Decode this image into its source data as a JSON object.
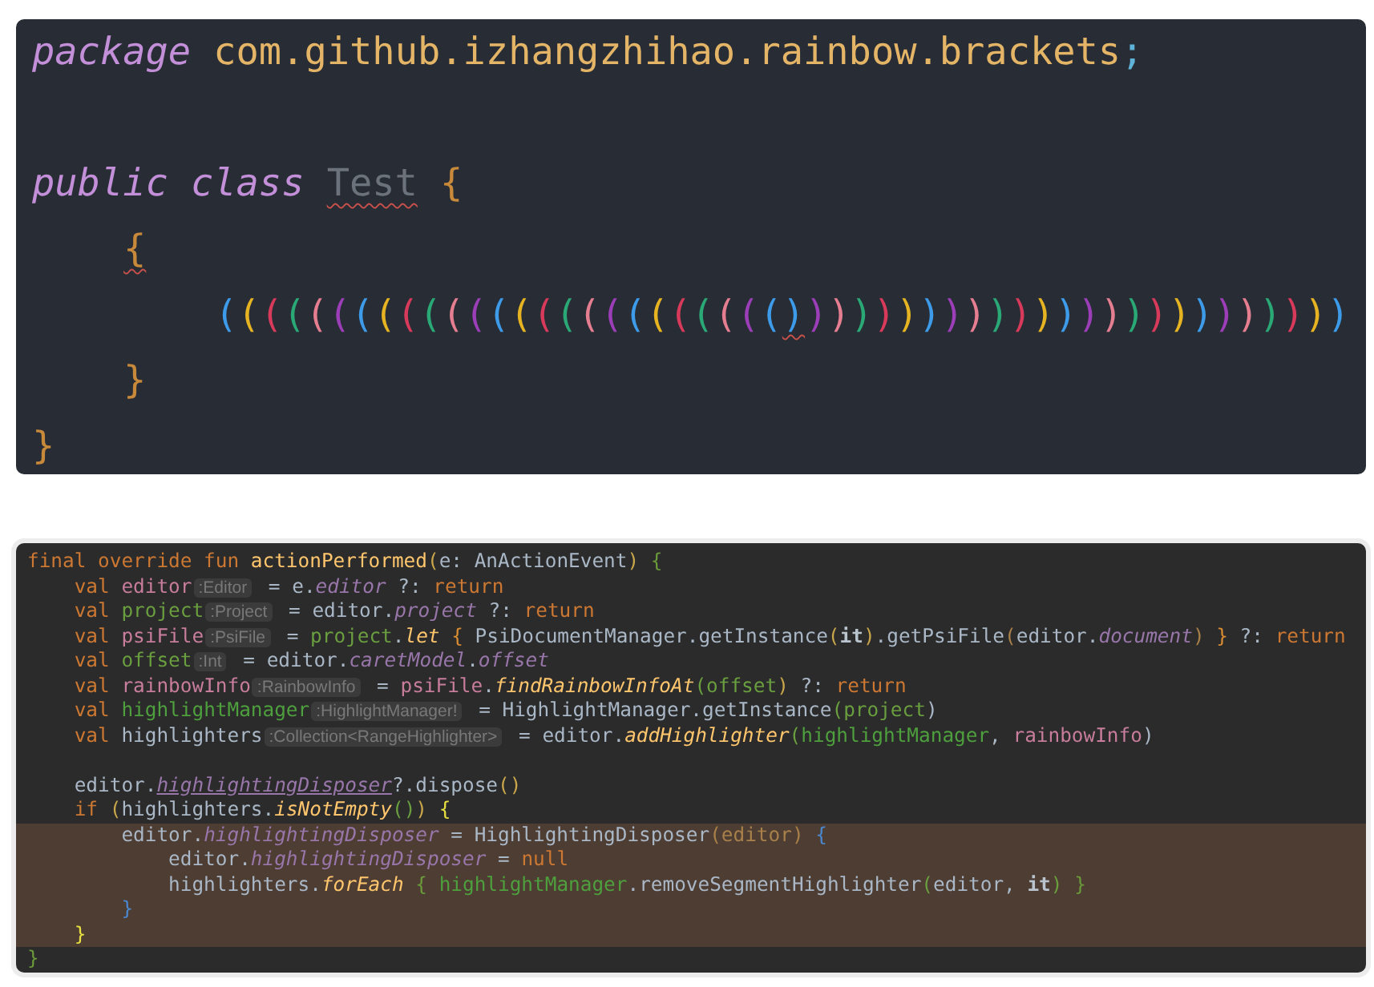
{
  "top_editor": {
    "lines": [
      {
        "kind": "code",
        "spaced": false,
        "tokens": [
          {
            "text": "package",
            "kind": "kw",
            "warned": false
          },
          {
            "text": "com.github.izhangzhihao.rainbow.brackets",
            "kind": "pkg",
            "warned": false
          },
          {
            "text": ";",
            "kind": "semi",
            "warned": false
          }
        ]
      },
      {
        "kind": "code",
        "spaced": true,
        "tokens": [
          {
            "text": "public",
            "kind": "kw",
            "warned": false
          },
          {
            "text": "class",
            "kind": "kw",
            "warned": false
          },
          {
            "text": "Test",
            "kind": "unused",
            "warned": true
          },
          {
            "text": "{",
            "kind": "brace",
            "warned": false
          }
        ],
        "children": [
          {
            "kind": "code",
            "spaced": false,
            "tokens": [
              {
                "text": "{",
                "kind": "brace",
                "warned": true
              }
            ],
            "children": [
              {
                "kind": "brackets",
                "spaced": false,
                "brackets": [
                  {
                    "text": "(",
                    "color": "#3d9be9",
                    "warned": false
                  },
                  {
                    "text": "(",
                    "color": "#e6b422",
                    "warned": false
                  },
                  {
                    "text": "(",
                    "color": "#d73a5a",
                    "warned": false
                  },
                  {
                    "text": "(",
                    "color": "#2aa876",
                    "warned": false
                  },
                  {
                    "text": "(",
                    "color": "#e57e90",
                    "warned": false
                  },
                  {
                    "text": "(",
                    "color": "#9c3eb8",
                    "warned": false
                  },
                  {
                    "text": "(",
                    "color": "#3d9be9",
                    "warned": false
                  },
                  {
                    "text": "(",
                    "color": "#e6b422",
                    "warned": false
                  },
                  {
                    "text": "(",
                    "color": "#d73a5a",
                    "warned": false
                  },
                  {
                    "text": "(",
                    "color": "#2aa876",
                    "warned": false
                  },
                  {
                    "text": "(",
                    "color": "#e57e90",
                    "warned": false
                  },
                  {
                    "text": "(",
                    "color": "#9c3eb8",
                    "warned": false
                  },
                  {
                    "text": "(",
                    "color": "#3d9be9",
                    "warned": false
                  },
                  {
                    "text": "(",
                    "color": "#e6b422",
                    "warned": false
                  },
                  {
                    "text": "(",
                    "color": "#d73a5a",
                    "warned": false
                  },
                  {
                    "text": "(",
                    "color": "#2aa876",
                    "warned": false
                  },
                  {
                    "text": "(",
                    "color": "#e57e90",
                    "warned": false
                  },
                  {
                    "text": "(",
                    "color": "#9c3eb8",
                    "warned": false
                  },
                  {
                    "text": "(",
                    "color": "#3d9be9",
                    "warned": false
                  },
                  {
                    "text": "(",
                    "color": "#e6b422",
                    "warned": false
                  },
                  {
                    "text": "(",
                    "color": "#d73a5a",
                    "warned": false
                  },
                  {
                    "text": "(",
                    "color": "#2aa876",
                    "warned": false
                  },
                  {
                    "text": "(",
                    "color": "#e57e90",
                    "warned": false
                  },
                  {
                    "text": "(",
                    "color": "#9c3eb8",
                    "warned": false
                  },
                  {
                    "text": "(",
                    "color": "#3d9be9",
                    "warned": false
                  },
                  {
                    "text": ")",
                    "color": "#3d9be9",
                    "warned": true
                  },
                  {
                    "text": ")",
                    "color": "#9c3eb8",
                    "warned": false
                  },
                  {
                    "text": ")",
                    "color": "#e57e90",
                    "warned": false
                  },
                  {
                    "text": ")",
                    "color": "#2aa876",
                    "warned": false
                  },
                  {
                    "text": ")",
                    "color": "#d73a5a",
                    "warned": false
                  },
                  {
                    "text": ")",
                    "color": "#e6b422",
                    "warned": false
                  },
                  {
                    "text": ")",
                    "color": "#3d9be9",
                    "warned": false
                  },
                  {
                    "text": ")",
                    "color": "#9c3eb8",
                    "warned": false
                  },
                  {
                    "text": ")",
                    "color": "#e57e90",
                    "warned": false
                  },
                  {
                    "text": ")",
                    "color": "#2aa876",
                    "warned": false
                  },
                  {
                    "text": ")",
                    "color": "#d73a5a",
                    "warned": false
                  },
                  {
                    "text": ")",
                    "color": "#e6b422",
                    "warned": false
                  },
                  {
                    "text": ")",
                    "color": "#3d9be9",
                    "warned": false
                  },
                  {
                    "text": ")",
                    "color": "#9c3eb8",
                    "warned": false
                  },
                  {
                    "text": ")",
                    "color": "#e57e90",
                    "warned": false
                  },
                  {
                    "text": ")",
                    "color": "#2aa876",
                    "warned": false
                  },
                  {
                    "text": ")",
                    "color": "#d73a5a",
                    "warned": false
                  },
                  {
                    "text": ")",
                    "color": "#e6b422",
                    "warned": false
                  },
                  {
                    "text": ")",
                    "color": "#3d9be9",
                    "warned": false
                  },
                  {
                    "text": ")",
                    "color": "#9c3eb8",
                    "warned": false
                  },
                  {
                    "text": ")",
                    "color": "#e57e90",
                    "warned": false
                  },
                  {
                    "text": ")",
                    "color": "#2aa876",
                    "warned": false
                  },
                  {
                    "text": ")",
                    "color": "#d73a5a",
                    "warned": false
                  },
                  {
                    "text": ")",
                    "color": "#e6b422",
                    "warned": false
                  },
                  {
                    "text": ")",
                    "color": "#3d9be9",
                    "warned": false
                  }
                ]
              }
            ]
          },
          {
            "kind": "code",
            "spaced": false,
            "tokens": [
              {
                "text": "}",
                "kind": "brace",
                "warned": false
              }
            ]
          }
        ]
      },
      {
        "kind": "code",
        "spaced": false,
        "tokens": [
          {
            "text": "}",
            "kind": "brace",
            "warned": false
          }
        ]
      }
    ]
  },
  "bottom_editor": {
    "blocks": [
      {
        "lines": [
          {
            "highlighted": false,
            "tokens": [
              {
                "text": "final override fun ",
                "kind": "kw"
              },
              {
                "text": "actionPerformed",
                "kind": "fn-plain"
              },
              {
                "text": "(",
                "kind": "c",
                "color": "#c9a64a"
              },
              {
                "text": "e: AnActionEvent",
                "kind": "text"
              },
              {
                "text": ") ",
                "kind": "c",
                "color": "#c9a64a"
              },
              {
                "text": "{",
                "kind": "c",
                "color": "#6a9a3a"
              }
            ]
          },
          {
            "highlighted": false,
            "tokens": [
              {
                "text": "    val ",
                "kind": "kw"
              },
              {
                "text": "editor",
                "kind": "c",
                "color": "#c77d9b"
              },
              {
                "text": ":Editor",
                "kind": "hint"
              },
              {
                "text": " = e.",
                "kind": "text"
              },
              {
                "text": "editor",
                "kind": "prop"
              },
              {
                "text": " ?: ",
                "kind": "text"
              },
              {
                "text": "return",
                "kind": "kw"
              }
            ]
          },
          {
            "highlighted": false,
            "tokens": [
              {
                "text": "    val ",
                "kind": "kw"
              },
              {
                "text": "project",
                "kind": "c",
                "color": "#6a9f3f"
              },
              {
                "text": ":Project",
                "kind": "hint"
              },
              {
                "text": " = editor.",
                "kind": "text"
              },
              {
                "text": "project",
                "kind": "prop"
              },
              {
                "text": " ?: ",
                "kind": "text"
              },
              {
                "text": "return",
                "kind": "kw"
              }
            ]
          },
          {
            "highlighted": false,
            "tokens": [
              {
                "text": "    val ",
                "kind": "kw"
              },
              {
                "text": "psiFile",
                "kind": "c",
                "color": "#c77d9b"
              },
              {
                "text": ":PsiFile",
                "kind": "hint"
              },
              {
                "text": " = ",
                "kind": "text"
              },
              {
                "text": "project",
                "kind": "c",
                "color": "#6a9f3f"
              },
              {
                "text": ".",
                "kind": "text"
              },
              {
                "text": "let ",
                "kind": "fn"
              },
              {
                "text": "{",
                "kind": "c",
                "color": "#d98c32"
              },
              {
                "text": " PsiDocumentManager.getInstance",
                "kind": "text"
              },
              {
                "text": "(",
                "kind": "c",
                "color": "#c9a64a"
              },
              {
                "text": "it",
                "kind": "bold"
              },
              {
                "text": ")",
                "kind": "c",
                "color": "#c9a64a"
              },
              {
                "text": ".getPsiFile",
                "kind": "text"
              },
              {
                "text": "(",
                "kind": "c",
                "color": "#a8804a"
              },
              {
                "text": "editor.",
                "kind": "text"
              },
              {
                "text": "document",
                "kind": "prop"
              },
              {
                "text": ") ",
                "kind": "c",
                "color": "#a8804a"
              },
              {
                "text": "}",
                "kind": "c",
                "color": "#d98c32"
              },
              {
                "text": " ?: ",
                "kind": "text"
              },
              {
                "text": "return",
                "kind": "kw"
              }
            ]
          },
          {
            "highlighted": false,
            "tokens": [
              {
                "text": "    val ",
                "kind": "kw"
              },
              {
                "text": "offset",
                "kind": "c",
                "color": "#6a9f3f"
              },
              {
                "text": ":Int",
                "kind": "hint"
              },
              {
                "text": " = editor.",
                "kind": "text"
              },
              {
                "text": "caretModel",
                "kind": "prop"
              },
              {
                "text": ".",
                "kind": "text"
              },
              {
                "text": "offset",
                "kind": "prop"
              }
            ]
          },
          {
            "highlighted": false,
            "tokens": [
              {
                "text": "    val ",
                "kind": "kw"
              },
              {
                "text": "rainbowInfo",
                "kind": "c",
                "color": "#c77d9b"
              },
              {
                "text": ":RainbowInfo",
                "kind": "hint"
              },
              {
                "text": " = ",
                "kind": "text"
              },
              {
                "text": "psiFile",
                "kind": "c",
                "color": "#c77d9b"
              },
              {
                "text": ".",
                "kind": "text"
              },
              {
                "text": "findRainbowInfoAt",
                "kind": "fn"
              },
              {
                "text": "(",
                "kind": "c",
                "color": "#6a9f3f"
              },
              {
                "text": "offset",
                "kind": "c",
                "color": "#6a9f3f"
              },
              {
                "text": ")",
                "kind": "c",
                "color": "#c9a64a"
              },
              {
                "text": " ?: ",
                "kind": "text"
              },
              {
                "text": "return",
                "kind": "kw"
              }
            ]
          },
          {
            "highlighted": false,
            "tokens": [
              {
                "text": "    val ",
                "kind": "kw"
              },
              {
                "text": "highlightManager",
                "kind": "c",
                "color": "#4e9f3d"
              },
              {
                "text": ":HighlightManager!",
                "kind": "hint"
              },
              {
                "text": " = HighlightManager.getInstance",
                "kind": "text"
              },
              {
                "text": "(",
                "kind": "c",
                "color": "#6a9f3f"
              },
              {
                "text": "project",
                "kind": "c",
                "color": "#6a9f3f"
              },
              {
                "text": ")",
                "kind": "c",
                "color": "#a9b7c6"
              }
            ]
          },
          {
            "highlighted": false,
            "tokens": [
              {
                "text": "    val ",
                "kind": "kw"
              },
              {
                "text": "highlighters",
                "kind": "text"
              },
              {
                "text": ":Collection<RangeHighlighter>",
                "kind": "hint"
              },
              {
                "text": " = editor.",
                "kind": "text"
              },
              {
                "text": "addHighlighter",
                "kind": "fn"
              },
              {
                "text": "(",
                "kind": "c",
                "color": "#6a9f3f"
              },
              {
                "text": "highlightManager",
                "kind": "c",
                "color": "#4e9f3d"
              },
              {
                "text": ", ",
                "kind": "text"
              },
              {
                "text": "rainbowInfo",
                "kind": "c",
                "color": "#c77d9b"
              },
              {
                "text": ")",
                "kind": "c",
                "color": "#a9b7c6"
              }
            ]
          }
        ]
      },
      {
        "lines": [
          {
            "highlighted": false,
            "tokens": [
              {
                "text": "    editor.",
                "kind": "text"
              },
              {
                "text": "highlightingDisposer",
                "kind": "prop-underlined"
              },
              {
                "text": "?.dispose",
                "kind": "text"
              },
              {
                "text": "()",
                "kind": "c",
                "color": "#c9a64a"
              }
            ]
          },
          {
            "highlighted": false,
            "tokens": [
              {
                "text": "    if ",
                "kind": "kw"
              },
              {
                "text": "(",
                "kind": "c",
                "color": "#c9a64a"
              },
              {
                "text": "highlighters.",
                "kind": "text"
              },
              {
                "text": "isNotEmpty",
                "kind": "fn"
              },
              {
                "text": "()",
                "kind": "c",
                "color": "#6a9f3f"
              },
              {
                "text": ") ",
                "kind": "c",
                "color": "#c9a64a"
              },
              {
                "text": "{",
                "kind": "c",
                "color": "#e8e040"
              }
            ]
          },
          {
            "highlighted": true,
            "tokens": [
              {
                "text": "        editor.",
                "kind": "text"
              },
              {
                "text": "highlightingDisposer",
                "kind": "prop"
              },
              {
                "text": " = HighlightingDisposer",
                "kind": "text"
              },
              {
                "text": "(",
                "kind": "c",
                "color": "#a8804a"
              },
              {
                "text": "editor",
                "kind": "c",
                "color": "#a8804a"
              },
              {
                "text": ") ",
                "kind": "c",
                "color": "#a8804a"
              },
              {
                "text": "{",
                "kind": "c",
                "color": "#4a88d0"
              }
            ]
          },
          {
            "highlighted": true,
            "tokens": [
              {
                "text": "            editor.",
                "kind": "text"
              },
              {
                "text": "highlightingDisposer",
                "kind": "prop"
              },
              {
                "text": " = ",
                "kind": "text"
              },
              {
                "text": "null",
                "kind": "kw"
              }
            ]
          },
          {
            "highlighted": true,
            "tokens": [
              {
                "text": "            highlighters.",
                "kind": "text"
              },
              {
                "text": "forEach ",
                "kind": "fn"
              },
              {
                "text": "{",
                "kind": "c",
                "color": "#6a9a3a"
              },
              {
                "text": " highlightManager",
                "kind": "c",
                "color": "#4e9f3d"
              },
              {
                "text": ".removeSegmentHighlighter",
                "kind": "text"
              },
              {
                "text": "(",
                "kind": "c",
                "color": "#6a9f3f"
              },
              {
                "text": "editor, ",
                "kind": "text"
              },
              {
                "text": "it",
                "kind": "bold"
              },
              {
                "text": ") ",
                "kind": "c",
                "color": "#6a9f3f"
              },
              {
                "text": "}",
                "kind": "c",
                "color": "#6a9a3a"
              }
            ]
          },
          {
            "highlighted": true,
            "tokens": [
              {
                "text": "        }",
                "kind": "c",
                "color": "#4a88d0"
              }
            ]
          },
          {
            "highlighted": true,
            "tokens": [
              {
                "text": "    }",
                "kind": "c",
                "color": "#e8e040"
              }
            ]
          },
          {
            "highlighted": false,
            "tokens": [
              {
                "text": "}",
                "kind": "c",
                "color": "#6a9a3a"
              }
            ]
          }
        ]
      }
    ]
  }
}
